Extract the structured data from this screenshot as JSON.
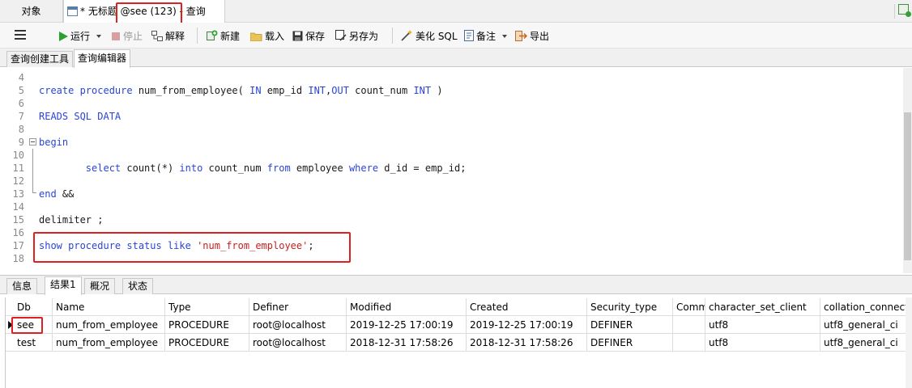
{
  "tabs": {
    "objects_label": "对象",
    "query_tab_prefix": "* 无标题",
    "query_tab_connection": "@see (123)",
    "query_tab_suffix": "- 查询"
  },
  "toolbar": {
    "run_label": "运行",
    "stop_label": "停止",
    "explain_label": "解释",
    "new_label": "新建",
    "load_label": "载入",
    "save_label": "保存",
    "save_as_label": "另存为",
    "beautify_label": "美化 SQL",
    "note_label": "备注",
    "export_label": "导出"
  },
  "subtabs": {
    "builder_label": "查询创建工具",
    "editor_label": "查询编辑器"
  },
  "editor": {
    "lines": [
      {
        "num": "4",
        "tokens": []
      },
      {
        "num": "5",
        "tokens": [
          {
            "t": "create procedure",
            "c": "kw"
          },
          {
            "t": " num_from_employee( ",
            "c": "plain"
          },
          {
            "t": "IN",
            "c": "kw"
          },
          {
            "t": " emp_id ",
            "c": "plain"
          },
          {
            "t": "INT",
            "c": "kw"
          },
          {
            "t": ",",
            "c": "plain"
          },
          {
            "t": "OUT",
            "c": "kw"
          },
          {
            "t": " count_num ",
            "c": "plain"
          },
          {
            "t": "INT",
            "c": "kw"
          },
          {
            "t": " )",
            "c": "plain"
          }
        ]
      },
      {
        "num": "6",
        "tokens": []
      },
      {
        "num": "7",
        "tokens": [
          {
            "t": "READS SQL DATA",
            "c": "kw"
          }
        ]
      },
      {
        "num": "8",
        "tokens": []
      },
      {
        "num": "9",
        "tokens": [
          {
            "t": "begin",
            "c": "kw"
          }
        ]
      },
      {
        "num": "10",
        "tokens": []
      },
      {
        "num": "11",
        "tokens": [
          {
            "t": "        ",
            "c": "plain"
          },
          {
            "t": "select",
            "c": "kw"
          },
          {
            "t": " count(*) ",
            "c": "plain"
          },
          {
            "t": "into",
            "c": "kw"
          },
          {
            "t": " count_num ",
            "c": "plain"
          },
          {
            "t": "from",
            "c": "kw"
          },
          {
            "t": " employee ",
            "c": "plain"
          },
          {
            "t": "where",
            "c": "kw"
          },
          {
            "t": " d_id = emp_id;",
            "c": "plain"
          }
        ]
      },
      {
        "num": "12",
        "tokens": []
      },
      {
        "num": "13",
        "tokens": [
          {
            "t": "end",
            "c": "kw"
          },
          {
            "t": " &&",
            "c": "plain"
          }
        ]
      },
      {
        "num": "14",
        "tokens": []
      },
      {
        "num": "15",
        "tokens": [
          {
            "t": "delimiter ;",
            "c": "plain"
          }
        ]
      },
      {
        "num": "16",
        "tokens": []
      },
      {
        "num": "17",
        "tokens": [
          {
            "t": "show procedure status like",
            "c": "kw"
          },
          {
            "t": " ",
            "c": "plain"
          },
          {
            "t": "'num_from_employee'",
            "c": "str"
          },
          {
            "t": ";",
            "c": "plain"
          }
        ]
      },
      {
        "num": "18",
        "tokens": []
      }
    ]
  },
  "result_tabs": {
    "info_label": "信息",
    "result1_label": "结果1",
    "profile_label": "概况",
    "status_label": "状态"
  },
  "grid": {
    "columns": [
      "Db",
      "Name",
      "Type",
      "Definer",
      "Modified",
      "Created",
      "Security_type",
      "Comm",
      "character_set_client",
      "collation_connect"
    ],
    "rows": [
      [
        "see",
        "num_from_employee",
        "PROCEDURE",
        "root@localhost",
        "2019-12-25 17:00:19",
        "2019-12-25 17:00:19",
        "DEFINER",
        "",
        "utf8",
        "utf8_general_ci"
      ],
      [
        "test",
        "num_from_employee",
        "PROCEDURE",
        "root@localhost",
        "2018-12-31 17:58:26",
        "2018-12-31 17:58:26",
        "DEFINER",
        "",
        "utf8",
        "utf8_general_ci"
      ]
    ]
  },
  "colors": {
    "keyword": "#2a45d6",
    "string": "#c82020",
    "highlight": "#e02020",
    "run_icon": "#2ca02c"
  }
}
